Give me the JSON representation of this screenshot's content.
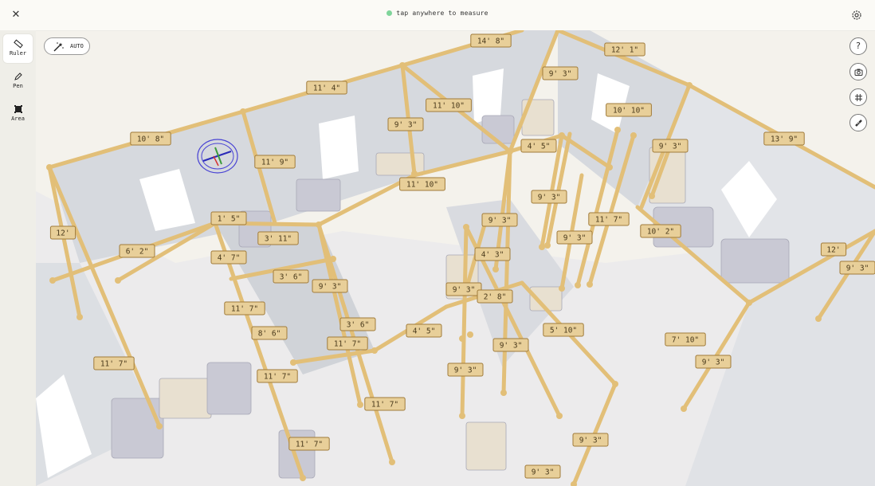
{
  "status": {
    "message": "tap anywhere to measure",
    "indicator_color": "#7fd49a"
  },
  "tools": [
    {
      "id": "ruler",
      "label": "Ruler",
      "active": true
    },
    {
      "id": "pen",
      "label": "Pen",
      "active": false
    },
    {
      "id": "area",
      "label": "Area",
      "active": false
    }
  ],
  "auto_button": {
    "label": "AUTO"
  },
  "right_tools": [
    {
      "id": "help",
      "icon": "help-icon",
      "glyph": "?"
    },
    {
      "id": "camera",
      "icon": "camera-icon"
    },
    {
      "id": "grid",
      "icon": "grid-icon"
    },
    {
      "id": "measure",
      "icon": "tape-measure-icon"
    }
  ],
  "colors": {
    "measure_line": "#e2bf78",
    "label_fill": "#e8cf99",
    "label_border": "#a07b3a",
    "label_text": "#4a3a1c",
    "wall": "#d5d8dd",
    "floor": "#ecebec"
  },
  "measurements": [
    {
      "text": "14' 8\""
    },
    {
      "text": "12' 1\""
    },
    {
      "text": "11' 4\""
    },
    {
      "text": "9' 3\""
    },
    {
      "text": "11' 10\""
    },
    {
      "text": "9' 3\""
    },
    {
      "text": "10' 10\""
    },
    {
      "text": "10' 8\""
    },
    {
      "text": "4' 5\""
    },
    {
      "text": "9' 3\""
    },
    {
      "text": "13' 9\""
    },
    {
      "text": "11' 9\""
    },
    {
      "text": "11' 10\""
    },
    {
      "text": "9' 3\""
    },
    {
      "text": "12'"
    },
    {
      "text": "1' 5\""
    },
    {
      "text": "9' 3\""
    },
    {
      "text": "11' 7\""
    },
    {
      "text": "10' 2\""
    },
    {
      "text": "3' 11\""
    },
    {
      "text": "9' 3\""
    },
    {
      "text": "6' 2\""
    },
    {
      "text": "4' 7\""
    },
    {
      "text": "4' 3\""
    },
    {
      "text": "12'"
    },
    {
      "text": "3' 6\""
    },
    {
      "text": "9' 3\""
    },
    {
      "text": "9' 3\""
    },
    {
      "text": "9' 3\""
    },
    {
      "text": "2' 8\""
    },
    {
      "text": "11' 7\""
    },
    {
      "text": "3' 6\""
    },
    {
      "text": "5' 10\""
    },
    {
      "text": "8' 6\""
    },
    {
      "text": "4' 5\""
    },
    {
      "text": "11' 7\""
    },
    {
      "text": "7' 10\""
    },
    {
      "text": "9' 3\""
    },
    {
      "text": "11' 7\""
    },
    {
      "text": "9' 3\""
    },
    {
      "text": "11' 7\""
    },
    {
      "text": "9' 3\""
    },
    {
      "text": "11' 7\""
    },
    {
      "text": "11' 7\""
    },
    {
      "text": "9' 3\""
    },
    {
      "text": "9' 3\""
    }
  ]
}
